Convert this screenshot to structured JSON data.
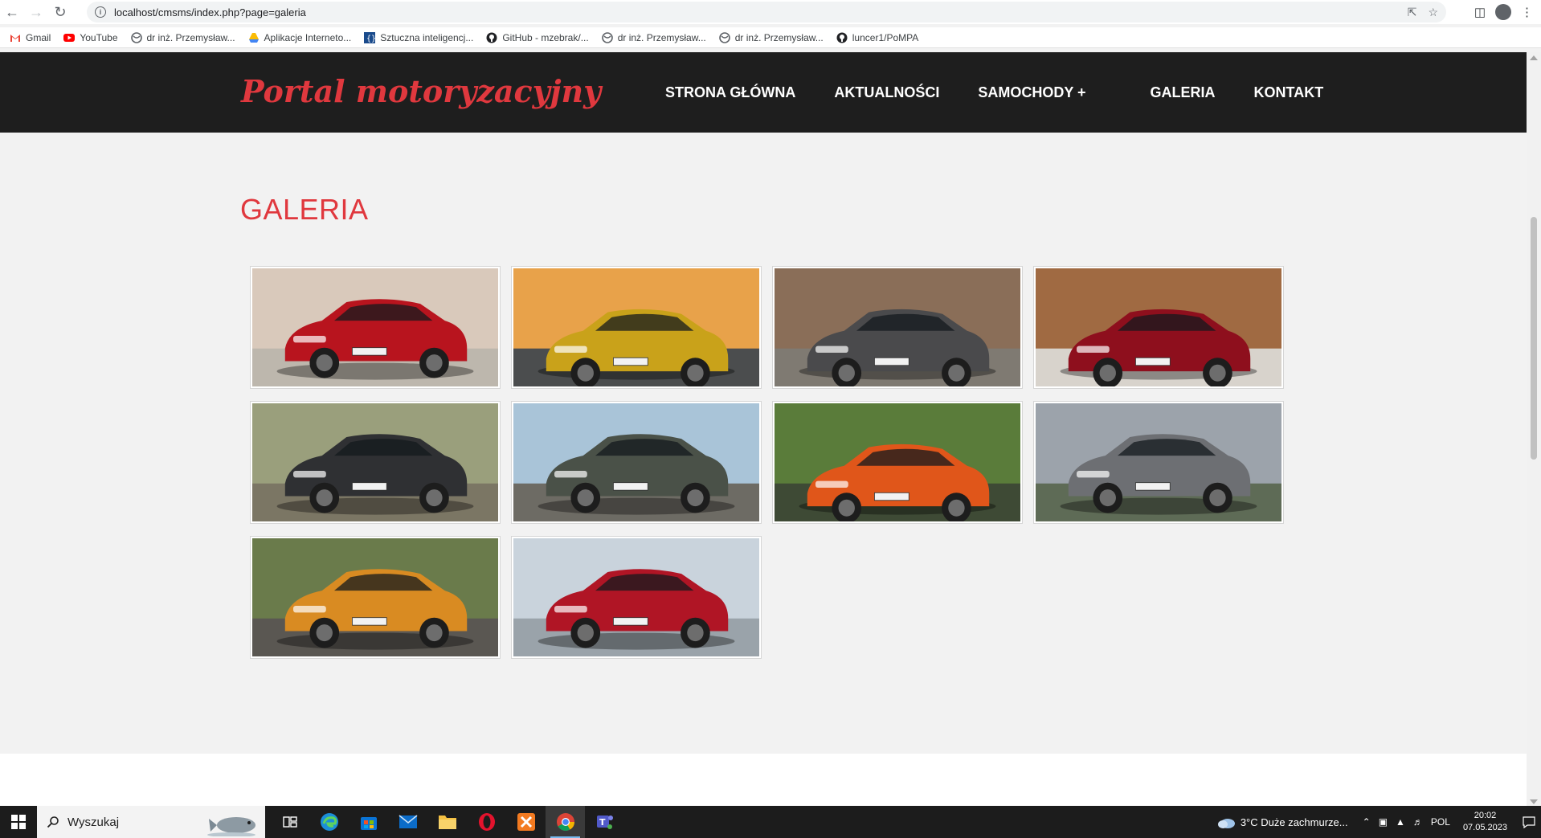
{
  "browser": {
    "url": "localhost/cmsms/index.php?page=galeria",
    "bookmarks": [
      {
        "label": "Gmail",
        "icon": "gmail-icon",
        "color": "#ea4335"
      },
      {
        "label": "YouTube",
        "icon": "youtube-icon",
        "color": "#ff0000"
      },
      {
        "label": "dr inż. Przemysław...",
        "icon": "globe-icon",
        "color": "#5f6368"
      },
      {
        "label": "Aplikacje Interneto...",
        "icon": "drive-icon",
        "color": "#fbbc04"
      },
      {
        "label": "Sztuczna inteligencj...",
        "icon": "bracket-icon",
        "color": "#1a4b8c"
      },
      {
        "label": "GitHub - mzebrak/...",
        "icon": "github-icon",
        "color": "#202124"
      },
      {
        "label": "dr inż. Przemysław...",
        "icon": "globe-icon",
        "color": "#5f6368"
      },
      {
        "label": "dr inż. Przemysław...",
        "icon": "globe-icon",
        "color": "#5f6368"
      },
      {
        "label": "luncer1/PoMPA",
        "icon": "github-icon",
        "color": "#202124"
      }
    ]
  },
  "site": {
    "logo": "Portal motoryzacyjny",
    "menu": [
      "STRONA GŁÓWNA",
      "AKTUALNOŚCI",
      "SAMOCHODY +",
      "GALERIA",
      "KONTAKT"
    ],
    "accent_color": "#e0383e",
    "header_color": "#1e1e1e"
  },
  "page": {
    "title": "GALERIA"
  },
  "gallery": [
    {
      "icon": "red-suv-photo",
      "car_color": "#b8141e",
      "bg": "#d9c9bb",
      "ground": "#bdb7ad"
    },
    {
      "icon": "yellow-hatchback-photo",
      "car_color": "#c9a21a",
      "bg": "#e8a24a",
      "ground": "#4b4d4e"
    },
    {
      "icon": "grey-sedan-photo",
      "car_color": "#4a4a4c",
      "bg": "#8a6e58",
      "ground": "#7f7a72"
    },
    {
      "icon": "red-coupe-photo",
      "car_color": "#8e0f1d",
      "bg": "#a06a42",
      "ground": "#d8d3cc"
    },
    {
      "icon": "black-suv-photo",
      "car_color": "#2f3033",
      "bg": "#9a9f7c",
      "ground": "#7b7664"
    },
    {
      "icon": "green-crossover-photo",
      "car_color": "#4a5148",
      "bg": "#a9c4d8",
      "ground": "#6d6b64"
    },
    {
      "icon": "orange-sportscar-photo",
      "car_color": "#e0561a",
      "bg": "#5a7c3a",
      "ground": "#3e4a35"
    },
    {
      "icon": "grey-muscle-car-photo",
      "car_color": "#6d6f73",
      "bg": "#9ca3ab",
      "ground": "#5e6b56"
    },
    {
      "icon": "orange-electric-suv-photo",
      "car_color": "#d98b22",
      "bg": "#6a7b4b",
      "ground": "#5a5752"
    },
    {
      "icon": "red-electric-sedan-photo",
      "car_color": "#b01525",
      "bg": "#c9d3dc",
      "ground": "#9aa3aa"
    }
  ],
  "taskbar": {
    "search_placeholder": "Wyszukaj",
    "apps": [
      "task-view-icon",
      "edge-icon",
      "store-icon",
      "mail-icon",
      "file-explorer-icon",
      "opera-icon",
      "xampp-icon",
      "chrome-icon",
      "teams-icon"
    ],
    "active_app": "chrome-icon",
    "weather": "3°C  Duże zachmurze...",
    "language": "POL",
    "time": "20:02",
    "date": "07.05.2023"
  }
}
